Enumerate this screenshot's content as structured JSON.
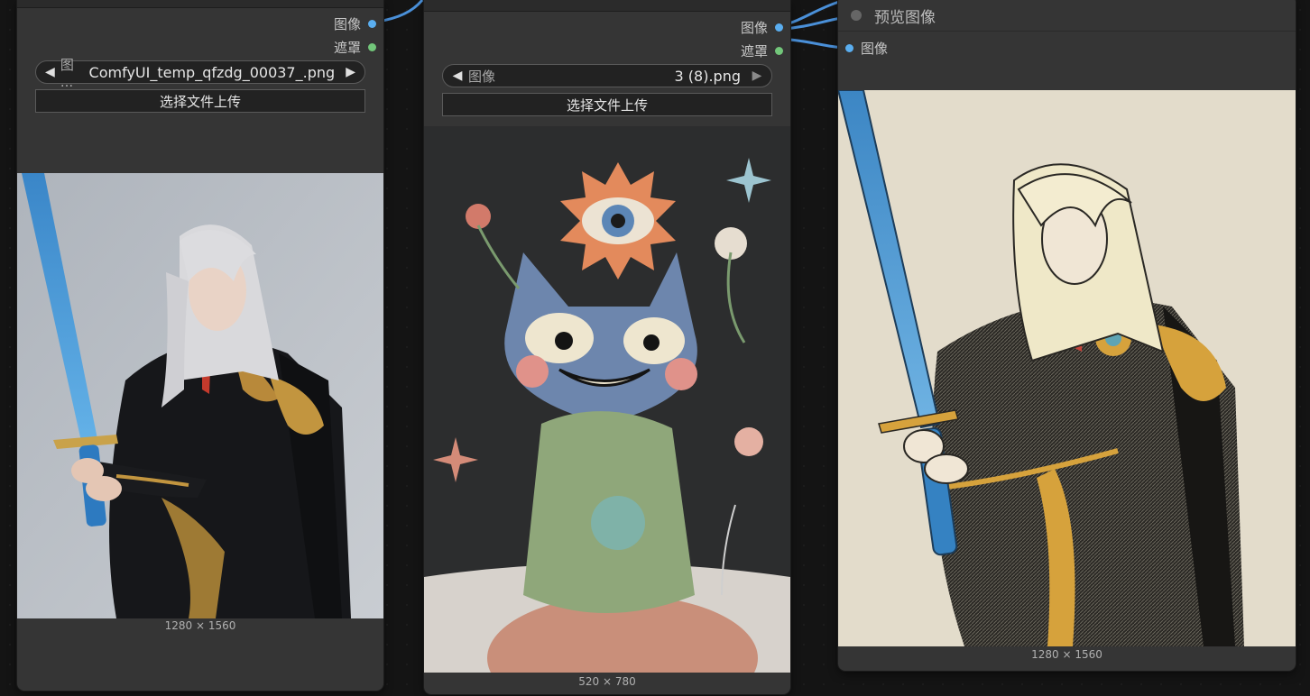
{
  "node1": {
    "outputs": [
      {
        "label": "图像",
        "color": "#5aaef0"
      },
      {
        "label": "遮罩",
        "color": "#72c67a"
      }
    ],
    "combo": {
      "name": "图 ...",
      "value": "ComfyUI_temp_qfzdg_00037_.png"
    },
    "upload_label": "选择文件上传",
    "dims": "1280 × 1560"
  },
  "node2": {
    "outputs": [
      {
        "label": "图像",
        "color": "#5aaef0"
      },
      {
        "label": "遮罩",
        "color": "#72c67a"
      }
    ],
    "combo": {
      "name": "图像",
      "value": "3 (8).png"
    },
    "upload_label": "选择文件上传",
    "dims": "520 × 780"
  },
  "node3": {
    "title": "预览图像",
    "input": {
      "label": "图像",
      "color": "#5aaef0"
    },
    "dims": "1280 × 1560"
  },
  "icons": {
    "left_arrow": "◀",
    "right_arrow": "▶",
    "dim_left_arrow": "◀",
    "dim_right_arrow": "▶"
  }
}
